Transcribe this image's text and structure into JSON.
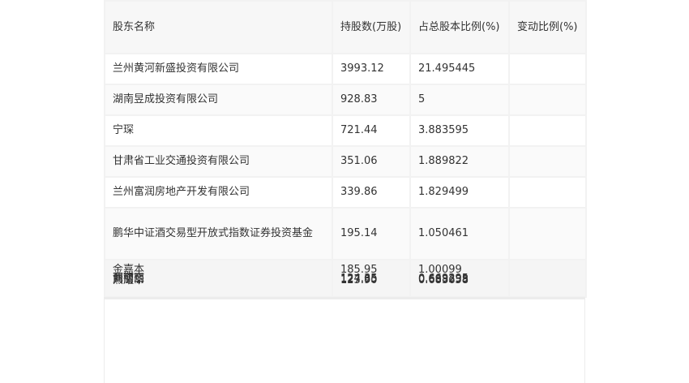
{
  "table": {
    "headers": {
      "name": "股东名称",
      "shares": "持股数(万股)",
      "pct": "占总股本比例(%)",
      "change": "变动比例(%)"
    },
    "rows": [
      {
        "name": "兰州黄河新盛投资有限公司",
        "shares": "3993.12",
        "pct": "21.495445",
        "change": ""
      },
      {
        "name": "湖南昱成投资有限公司",
        "shares": "928.83",
        "pct": "5",
        "change": ""
      },
      {
        "name": "宁琛",
        "shares": "721.44",
        "pct": "3.883595",
        "change": ""
      },
      {
        "name": "甘肃省工业交通投资有限公司",
        "shares": "351.06",
        "pct": "1.889822",
        "change": ""
      },
      {
        "name": "兰州富润房地产开发有限公司",
        "shares": "339.86",
        "pct": "1.829499",
        "change": ""
      },
      {
        "name": "鹏华中证酒交易型开放式指数证券投资基金",
        "shares": "195.14",
        "pct": "1.050461",
        "change": ""
      }
    ],
    "overlap_row": {
      "names": [
        "金嘉本",
        "贾丽丽",
        "刘丽丽",
        "熊耀华"
      ],
      "shares": [
        "185.95",
        "124.35",
        "127.85",
        "123.90"
      ],
      "pcts": [
        "1.00099",
        "0.669395",
        "0.688238",
        "0.683658"
      ],
      "change": ""
    }
  }
}
